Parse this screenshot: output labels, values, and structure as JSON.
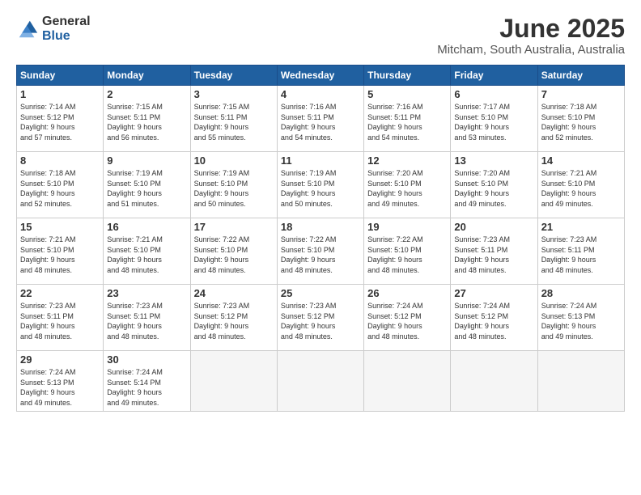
{
  "logo": {
    "general": "General",
    "blue": "Blue"
  },
  "header": {
    "month": "June 2025",
    "location": "Mitcham, South Australia, Australia"
  },
  "weekdays": [
    "Sunday",
    "Monday",
    "Tuesday",
    "Wednesday",
    "Thursday",
    "Friday",
    "Saturday"
  ],
  "weeks": [
    [
      {
        "day": "1",
        "sunrise": "7:14 AM",
        "sunset": "5:12 PM",
        "daylight": "9 hours and 57 minutes."
      },
      {
        "day": "2",
        "sunrise": "7:15 AM",
        "sunset": "5:11 PM",
        "daylight": "9 hours and 56 minutes."
      },
      {
        "day": "3",
        "sunrise": "7:15 AM",
        "sunset": "5:11 PM",
        "daylight": "9 hours and 55 minutes."
      },
      {
        "day": "4",
        "sunrise": "7:16 AM",
        "sunset": "5:11 PM",
        "daylight": "9 hours and 54 minutes."
      },
      {
        "day": "5",
        "sunrise": "7:16 AM",
        "sunset": "5:11 PM",
        "daylight": "9 hours and 54 minutes."
      },
      {
        "day": "6",
        "sunrise": "7:17 AM",
        "sunset": "5:10 PM",
        "daylight": "9 hours and 53 minutes."
      },
      {
        "day": "7",
        "sunrise": "7:18 AM",
        "sunset": "5:10 PM",
        "daylight": "9 hours and 52 minutes."
      }
    ],
    [
      {
        "day": "8",
        "sunrise": "7:18 AM",
        "sunset": "5:10 PM",
        "daylight": "9 hours and 52 minutes."
      },
      {
        "day": "9",
        "sunrise": "7:19 AM",
        "sunset": "5:10 PM",
        "daylight": "9 hours and 51 minutes."
      },
      {
        "day": "10",
        "sunrise": "7:19 AM",
        "sunset": "5:10 PM",
        "daylight": "9 hours and 50 minutes."
      },
      {
        "day": "11",
        "sunrise": "7:19 AM",
        "sunset": "5:10 PM",
        "daylight": "9 hours and 50 minutes."
      },
      {
        "day": "12",
        "sunrise": "7:20 AM",
        "sunset": "5:10 PM",
        "daylight": "9 hours and 49 minutes."
      },
      {
        "day": "13",
        "sunrise": "7:20 AM",
        "sunset": "5:10 PM",
        "daylight": "9 hours and 49 minutes."
      },
      {
        "day": "14",
        "sunrise": "7:21 AM",
        "sunset": "5:10 PM",
        "daylight": "9 hours and 49 minutes."
      }
    ],
    [
      {
        "day": "15",
        "sunrise": "7:21 AM",
        "sunset": "5:10 PM",
        "daylight": "9 hours and 48 minutes."
      },
      {
        "day": "16",
        "sunrise": "7:21 AM",
        "sunset": "5:10 PM",
        "daylight": "9 hours and 48 minutes."
      },
      {
        "day": "17",
        "sunrise": "7:22 AM",
        "sunset": "5:10 PM",
        "daylight": "9 hours and 48 minutes."
      },
      {
        "day": "18",
        "sunrise": "7:22 AM",
        "sunset": "5:10 PM",
        "daylight": "9 hours and 48 minutes."
      },
      {
        "day": "19",
        "sunrise": "7:22 AM",
        "sunset": "5:10 PM",
        "daylight": "9 hours and 48 minutes."
      },
      {
        "day": "20",
        "sunrise": "7:23 AM",
        "sunset": "5:11 PM",
        "daylight": "9 hours and 48 minutes."
      },
      {
        "day": "21",
        "sunrise": "7:23 AM",
        "sunset": "5:11 PM",
        "daylight": "9 hours and 48 minutes."
      }
    ],
    [
      {
        "day": "22",
        "sunrise": "7:23 AM",
        "sunset": "5:11 PM",
        "daylight": "9 hours and 48 minutes."
      },
      {
        "day": "23",
        "sunrise": "7:23 AM",
        "sunset": "5:11 PM",
        "daylight": "9 hours and 48 minutes."
      },
      {
        "day": "24",
        "sunrise": "7:23 AM",
        "sunset": "5:12 PM",
        "daylight": "9 hours and 48 minutes."
      },
      {
        "day": "25",
        "sunrise": "7:23 AM",
        "sunset": "5:12 PM",
        "daylight": "9 hours and 48 minutes."
      },
      {
        "day": "26",
        "sunrise": "7:24 AM",
        "sunset": "5:12 PM",
        "daylight": "9 hours and 48 minutes."
      },
      {
        "day": "27",
        "sunrise": "7:24 AM",
        "sunset": "5:12 PM",
        "daylight": "9 hours and 48 minutes."
      },
      {
        "day": "28",
        "sunrise": "7:24 AM",
        "sunset": "5:13 PM",
        "daylight": "9 hours and 49 minutes."
      }
    ],
    [
      {
        "day": "29",
        "sunrise": "7:24 AM",
        "sunset": "5:13 PM",
        "daylight": "9 hours and 49 minutes."
      },
      {
        "day": "30",
        "sunrise": "7:24 AM",
        "sunset": "5:14 PM",
        "daylight": "9 hours and 49 minutes."
      },
      null,
      null,
      null,
      null,
      null
    ]
  ]
}
